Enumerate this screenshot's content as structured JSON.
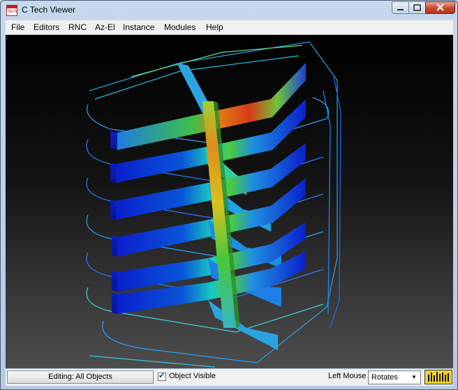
{
  "window": {
    "title": "C Tech Viewer",
    "icon_text": "Tech"
  },
  "menu": [
    "File",
    "Editors",
    "RNC",
    "Az-El",
    "Instance",
    "Modules",
    "Help"
  ],
  "status": {
    "editing_label": "Editing: All Objects",
    "object_visible_label": "Object Visible",
    "object_visible_checked": true,
    "left_mouse_label": "Left Mouse",
    "left_mouse_mode": "Rotates"
  },
  "colors": {
    "menu_bg": "#f0f0f0",
    "meter": "#f2d32a",
    "close_button": "#c9452f"
  }
}
